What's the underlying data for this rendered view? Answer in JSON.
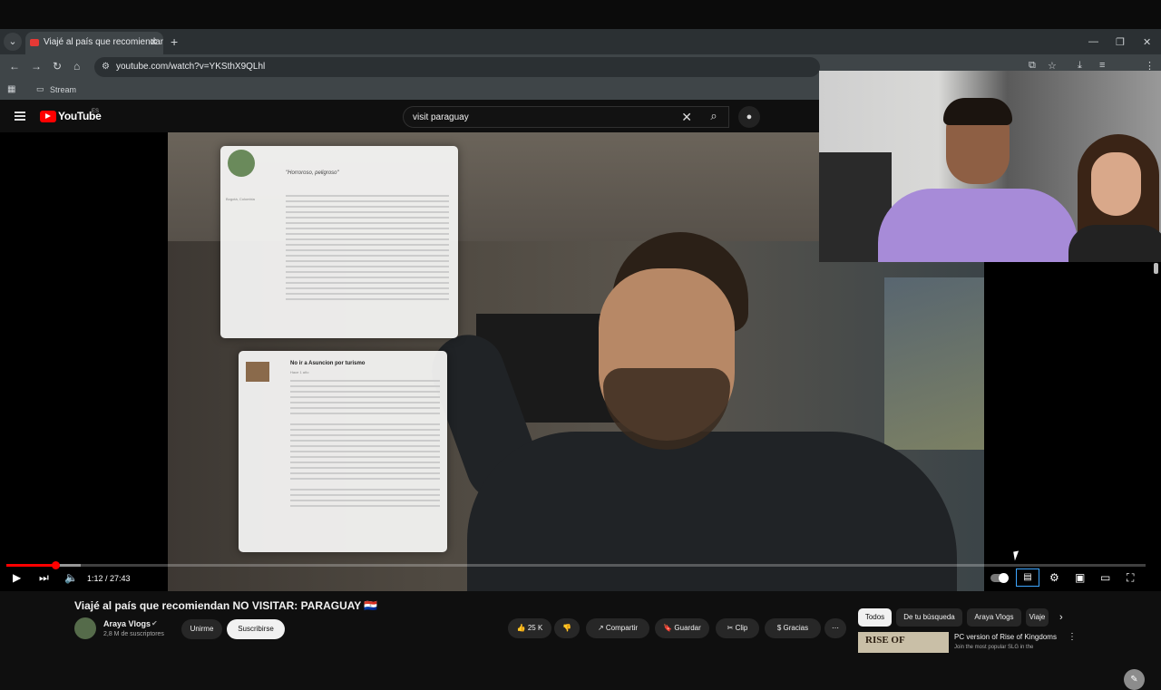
{
  "browser": {
    "tab_title": "Viajé al país que recomiendan NO VISITAR: PARAGUAY",
    "url": "youtube.com/watch?v=YKSthX9QLhl",
    "bookmark": "Stream",
    "tab_close": "✕",
    "new_tab": "+"
  },
  "youtube": {
    "logo_text": "YouTube",
    "country": "ES",
    "search_value": "visit paraguay"
  },
  "video_overlay": {
    "review1_title": "\"Horroroso, peligroso\"",
    "review1_user_location": "Bogotá, Colombia",
    "review2_title": "No ir a Asuncion por turismo",
    "review2_date": "Hace 1 año"
  },
  "player": {
    "time": "1:12 / 27:43",
    "progress_fraction": 0.043,
    "buffer_fraction": 0.065
  },
  "video_info": {
    "title": "Viajé al país que recomiendan NO VISITAR: PARAGUAY 🇵🇾",
    "channel_name": "Araya Vlogs",
    "subscribers": "2,8 M de suscriptores",
    "join_label": "Unirme",
    "subscribe_label": "Suscribirse",
    "likes": "25 K",
    "share_label": "Compartir",
    "save_label": "Guardar",
    "clip_label": "Clip",
    "thanks_label": "Gracias"
  },
  "sidebar": {
    "chips": [
      "Todos",
      "De tu búsqueda",
      "Araya Vlogs",
      "Viaje"
    ],
    "ad_thumb_text": "RISE OF",
    "ad_title": "PC version of Rise of Kingdoms",
    "ad_sub": "Join the most popular SLG in the"
  },
  "colors": {
    "accent_red": "#ff0000",
    "focus_blue": "#3ea6ff"
  }
}
